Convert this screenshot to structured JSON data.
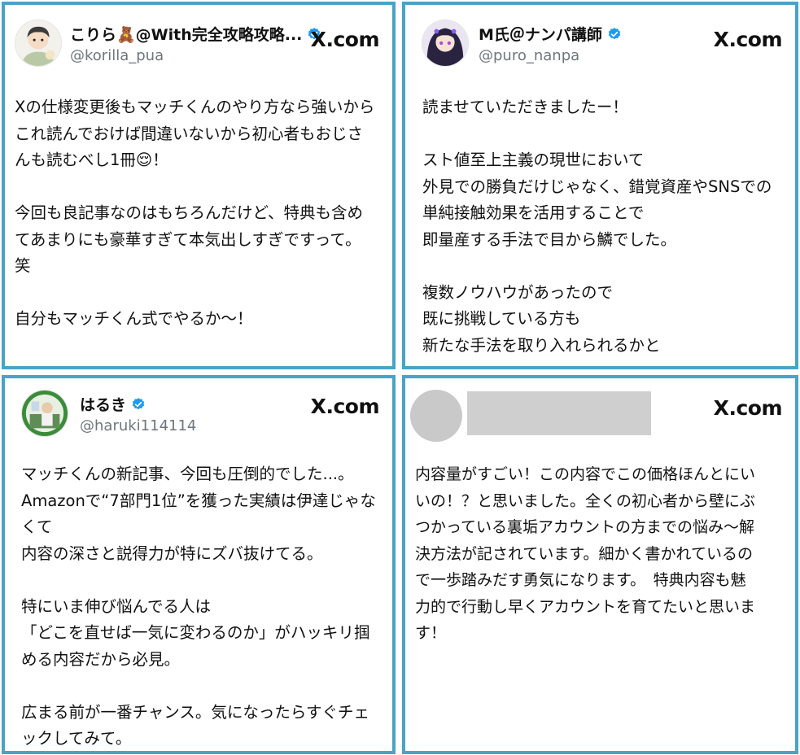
{
  "cards": [
    {
      "name": "こりら🧸@With完全攻略攻略...",
      "handle": "@korilla_pua",
      "source": "X.com",
      "text": "Xの仕様変更後もマッチくんのやり方なら強いから\nこれ読んでおけば間違いないから初心者もおじさ\nんも読むべし1冊😌！\n\n今回も良記事なのはもちろんだけど、特典も含め\nてあまりにも豪華すぎて本気出しすぎですって。\n笑\n\n自分もマッチくん式でやるか〜！",
      "verified": true
    },
    {
      "name": "M氏＠ナンパ講師",
      "handle": "@puro_nanpa",
      "source": "X.com",
      "text": "読ませていただきましたー！\n\nスト値至上主義の現世において\n外見での勝負だけじゃなく、錯覚資産やSNSでの\n単純接触効果を活用することで\n即量産する手法で目から鱗でした。\n\n複数ノウハウがあったので\n既に挑戦している方も\n新たな手法を取り入れられるかと",
      "verified": true
    },
    {
      "name": "はるき",
      "handle": "@haruki114114",
      "source": "X.com",
      "text": "マッチくんの新記事、今回も圧倒的でした...。\nAmazonで“7部門1位”を獲った実績は伊達じゃな\nくて\n内容の深さと説得力が特にズバ抜けてる。\n\n特にいま伸び悩んでる人は\n「どこを直せば一気に変わるのか」がハッキリ掴\nめる内容だから必見。\n\n広まる前が一番チャンス。気になったらすぐチェ\nックしてみて。",
      "verified": true
    },
    {
      "source": "X.com",
      "text": "内容量がすごい！この内容でこの価格ほんとにい\nいの！？と思いました。全くの初心者から壁にぶ\nつかっている裏垢アカウントの方までの悩み〜解\n決方法が記されています。細かく書かれているの\nで一歩踏みだす勇気になります。　特典内容も魅\n力的で行動し早くアカウントを育てたいと思いま\nす！"
    }
  ],
  "colors": {
    "card_border": "#4aa3c4",
    "verified_blue": "#1d9bf0",
    "handle_gray": "#6e767d",
    "redaction_gray": "#cfcfcf"
  },
  "icons": [
    "verified-badge-icon",
    "x-logo-icon"
  ]
}
